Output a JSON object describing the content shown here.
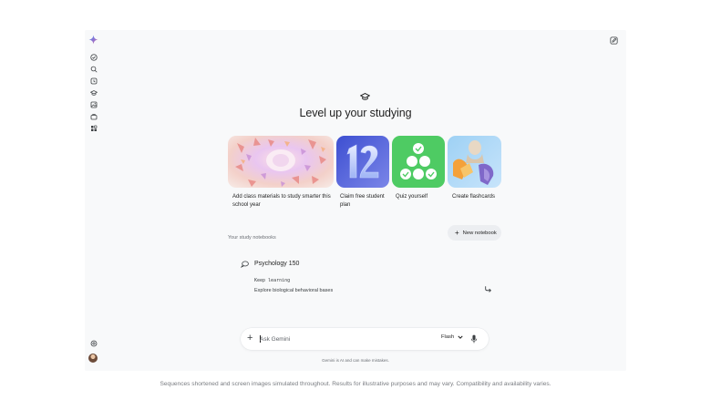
{
  "app": {
    "logo_icon": "gemini-sparkle-icon",
    "brand_colors": [
      "#4285f4",
      "#9b72cb",
      "#d96570"
    ]
  },
  "rail": {
    "items": [
      {
        "icon": "check-circle-icon"
      },
      {
        "icon": "search-icon"
      },
      {
        "icon": "history-icon"
      },
      {
        "icon": "graduation-cap-icon"
      },
      {
        "icon": "image-icon"
      },
      {
        "icon": "briefcase-icon"
      },
      {
        "icon": "grid-icon"
      }
    ],
    "bottom": [
      {
        "icon": "settings-icon"
      },
      {
        "icon": "avatar"
      }
    ]
  },
  "header": {
    "edit_icon": "edit-icon"
  },
  "hero": {
    "icon": "graduation-cap-icon",
    "title": "Level up your studying"
  },
  "cards": [
    {
      "caption": "Add class materials to study smarter this school year",
      "image": "abstract-3d-art"
    },
    {
      "caption": "Claim free student plan",
      "image": "number-12-graphic"
    },
    {
      "caption": "Quiz yourself",
      "image": "checkmark-circles"
    },
    {
      "caption": "Create flashcards",
      "image": "statue-collage"
    }
  ],
  "notebooks": {
    "section_label": "Your study notebooks",
    "new_button": "New notebook",
    "items": [
      {
        "title": "Psychology 150",
        "note": "Keep learning",
        "subtitle": "Explore biological behavioral bases",
        "icon": "notebook-icon"
      }
    ]
  },
  "prompt": {
    "placeholder": "Ask Gemini",
    "model": "Flash",
    "mic_icon": "microphone-icon"
  },
  "disclaimer": "Gemini is AI and can make mistakes.",
  "footer": "Sequences shortened and screen images simulated throughout. Results for illustrative purposes and may vary. Compatibility and availability varies."
}
